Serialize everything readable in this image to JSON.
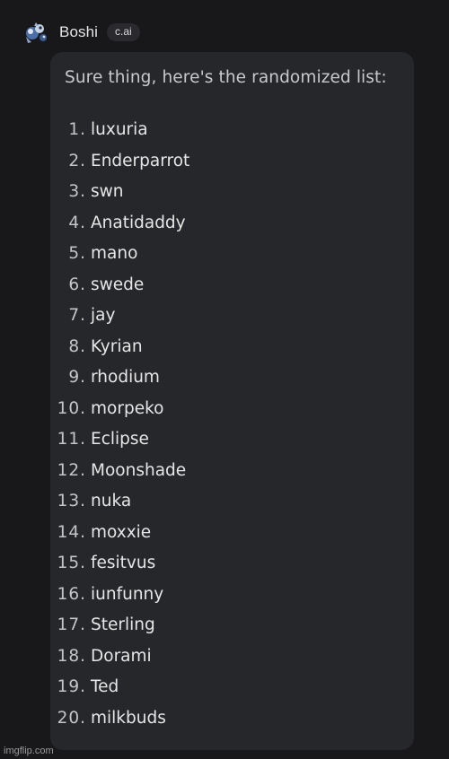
{
  "header": {
    "avatar_icon": "character-avatar-icon",
    "name": "Boshi",
    "badge": "c.ai"
  },
  "message": {
    "intro": "Sure thing, here's the randomized list:",
    "items": [
      {
        "number": "1.",
        "text": "luxuria"
      },
      {
        "number": "2.",
        "text": "Enderparrot"
      },
      {
        "number": "3.",
        "text": "swn"
      },
      {
        "number": "4.",
        "text": "Anatidaddy"
      },
      {
        "number": "5.",
        "text": "mano"
      },
      {
        "number": "6.",
        "text": "swede"
      },
      {
        "number": "7.",
        "text": "jay"
      },
      {
        "number": "8.",
        "text": "Kyrian"
      },
      {
        "number": "9.",
        "text": "rhodium"
      },
      {
        "number": "10.",
        "text": "morpeko"
      },
      {
        "number": "11.",
        "text": "Eclipse"
      },
      {
        "number": "12.",
        "text": "Moonshade"
      },
      {
        "number": "13.",
        "text": "nuka"
      },
      {
        "number": "14.",
        "text": "moxxie"
      },
      {
        "number": "15.",
        "text": "fesitvus"
      },
      {
        "number": "16.",
        "text": "iunfunny"
      },
      {
        "number": "17.",
        "text": "Sterling"
      },
      {
        "number": "18.",
        "text": "Dorami"
      },
      {
        "number": "19.",
        "text": "Ted"
      },
      {
        "number": "20.",
        "text": "milkbuds"
      }
    ]
  },
  "watermark": "imgflip.com",
  "colors": {
    "background": "#18181b",
    "bubble": "#26272b",
    "text": "#e6e6e6",
    "badge_bg": "#2a2a2e"
  }
}
